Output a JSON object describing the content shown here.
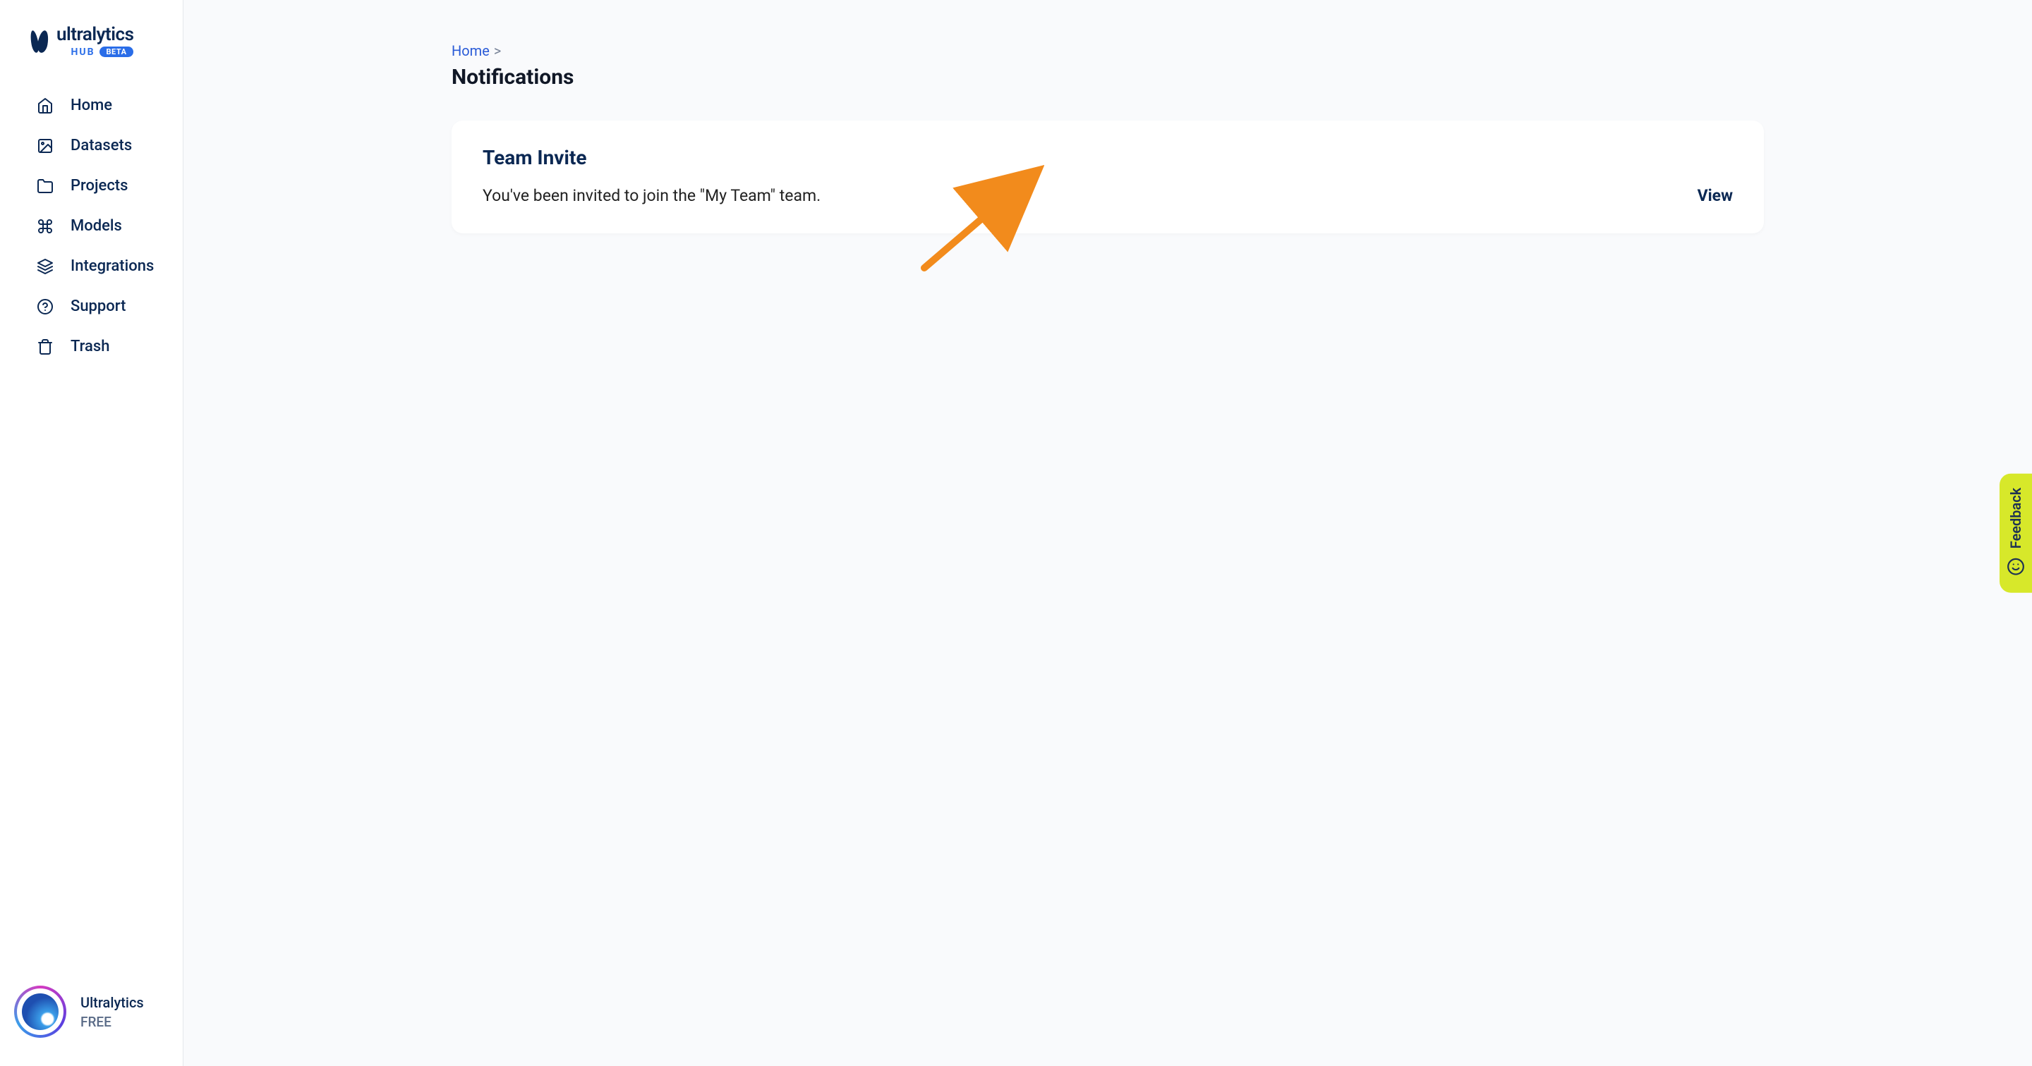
{
  "brand": {
    "name": "ultralytics",
    "sub": "HUB",
    "badge": "BETA"
  },
  "sidebar": {
    "items": [
      {
        "label": "Home",
        "icon": "home-icon"
      },
      {
        "label": "Datasets",
        "icon": "image-icon"
      },
      {
        "label": "Projects",
        "icon": "folder-icon"
      },
      {
        "label": "Models",
        "icon": "command-icon"
      },
      {
        "label": "Integrations",
        "icon": "layers-icon"
      },
      {
        "label": "Support",
        "icon": "help-icon"
      },
      {
        "label": "Trash",
        "icon": "trash-icon"
      }
    ]
  },
  "user": {
    "name": "Ultralytics",
    "plan": "FREE"
  },
  "breadcrumb": {
    "home_label": "Home",
    "separator": ">"
  },
  "page": {
    "title": "Notifications"
  },
  "notifications": [
    {
      "title": "Team Invite",
      "message": "You've been invited to join the \"My Team\" team.",
      "action_label": "View"
    }
  ],
  "feedback": {
    "label": "Feedback"
  }
}
